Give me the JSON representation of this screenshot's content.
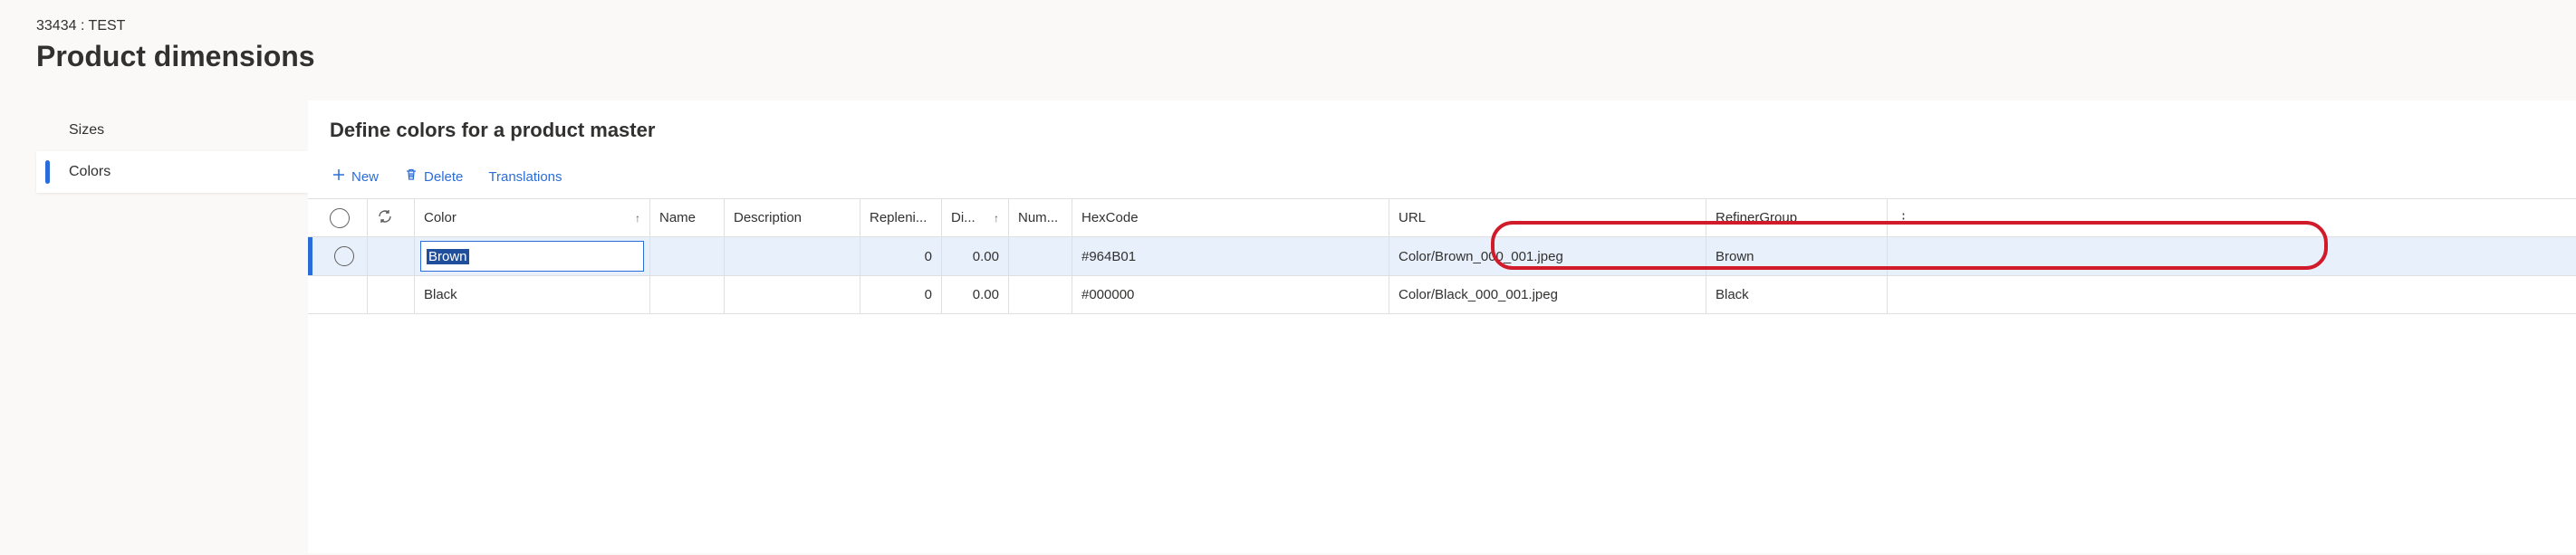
{
  "breadcrumb": "33434 : TEST",
  "page_title": "Product dimensions",
  "sidebar": {
    "items": [
      {
        "label": "Sizes",
        "active": false
      },
      {
        "label": "Colors",
        "active": true
      }
    ]
  },
  "section_title": "Define colors for a product master",
  "toolbar": {
    "new_label": "New",
    "delete_label": "Delete",
    "translations_label": "Translations"
  },
  "grid": {
    "headers": {
      "color": "Color",
      "name": "Name",
      "description": "Description",
      "replenishment": "Repleni...",
      "di": "Di...",
      "num": "Num...",
      "hexcode": "HexCode",
      "url": "URL",
      "refinergroup": "RefinerGroup"
    },
    "rows": [
      {
        "selected": true,
        "editing_color": true,
        "color": "Brown",
        "name": "",
        "description": "",
        "replenishment": "0",
        "di": "0.00",
        "num": "",
        "hexcode": "#964B01",
        "url": "Color/Brown_000_001.jpeg",
        "refinergroup": "Brown"
      },
      {
        "selected": false,
        "editing_color": false,
        "color": "Black",
        "name": "",
        "description": "",
        "replenishment": "0",
        "di": "0.00",
        "num": "",
        "hexcode": "#000000",
        "url": "Color/Black_000_001.jpeg",
        "refinergroup": "Black"
      }
    ]
  }
}
